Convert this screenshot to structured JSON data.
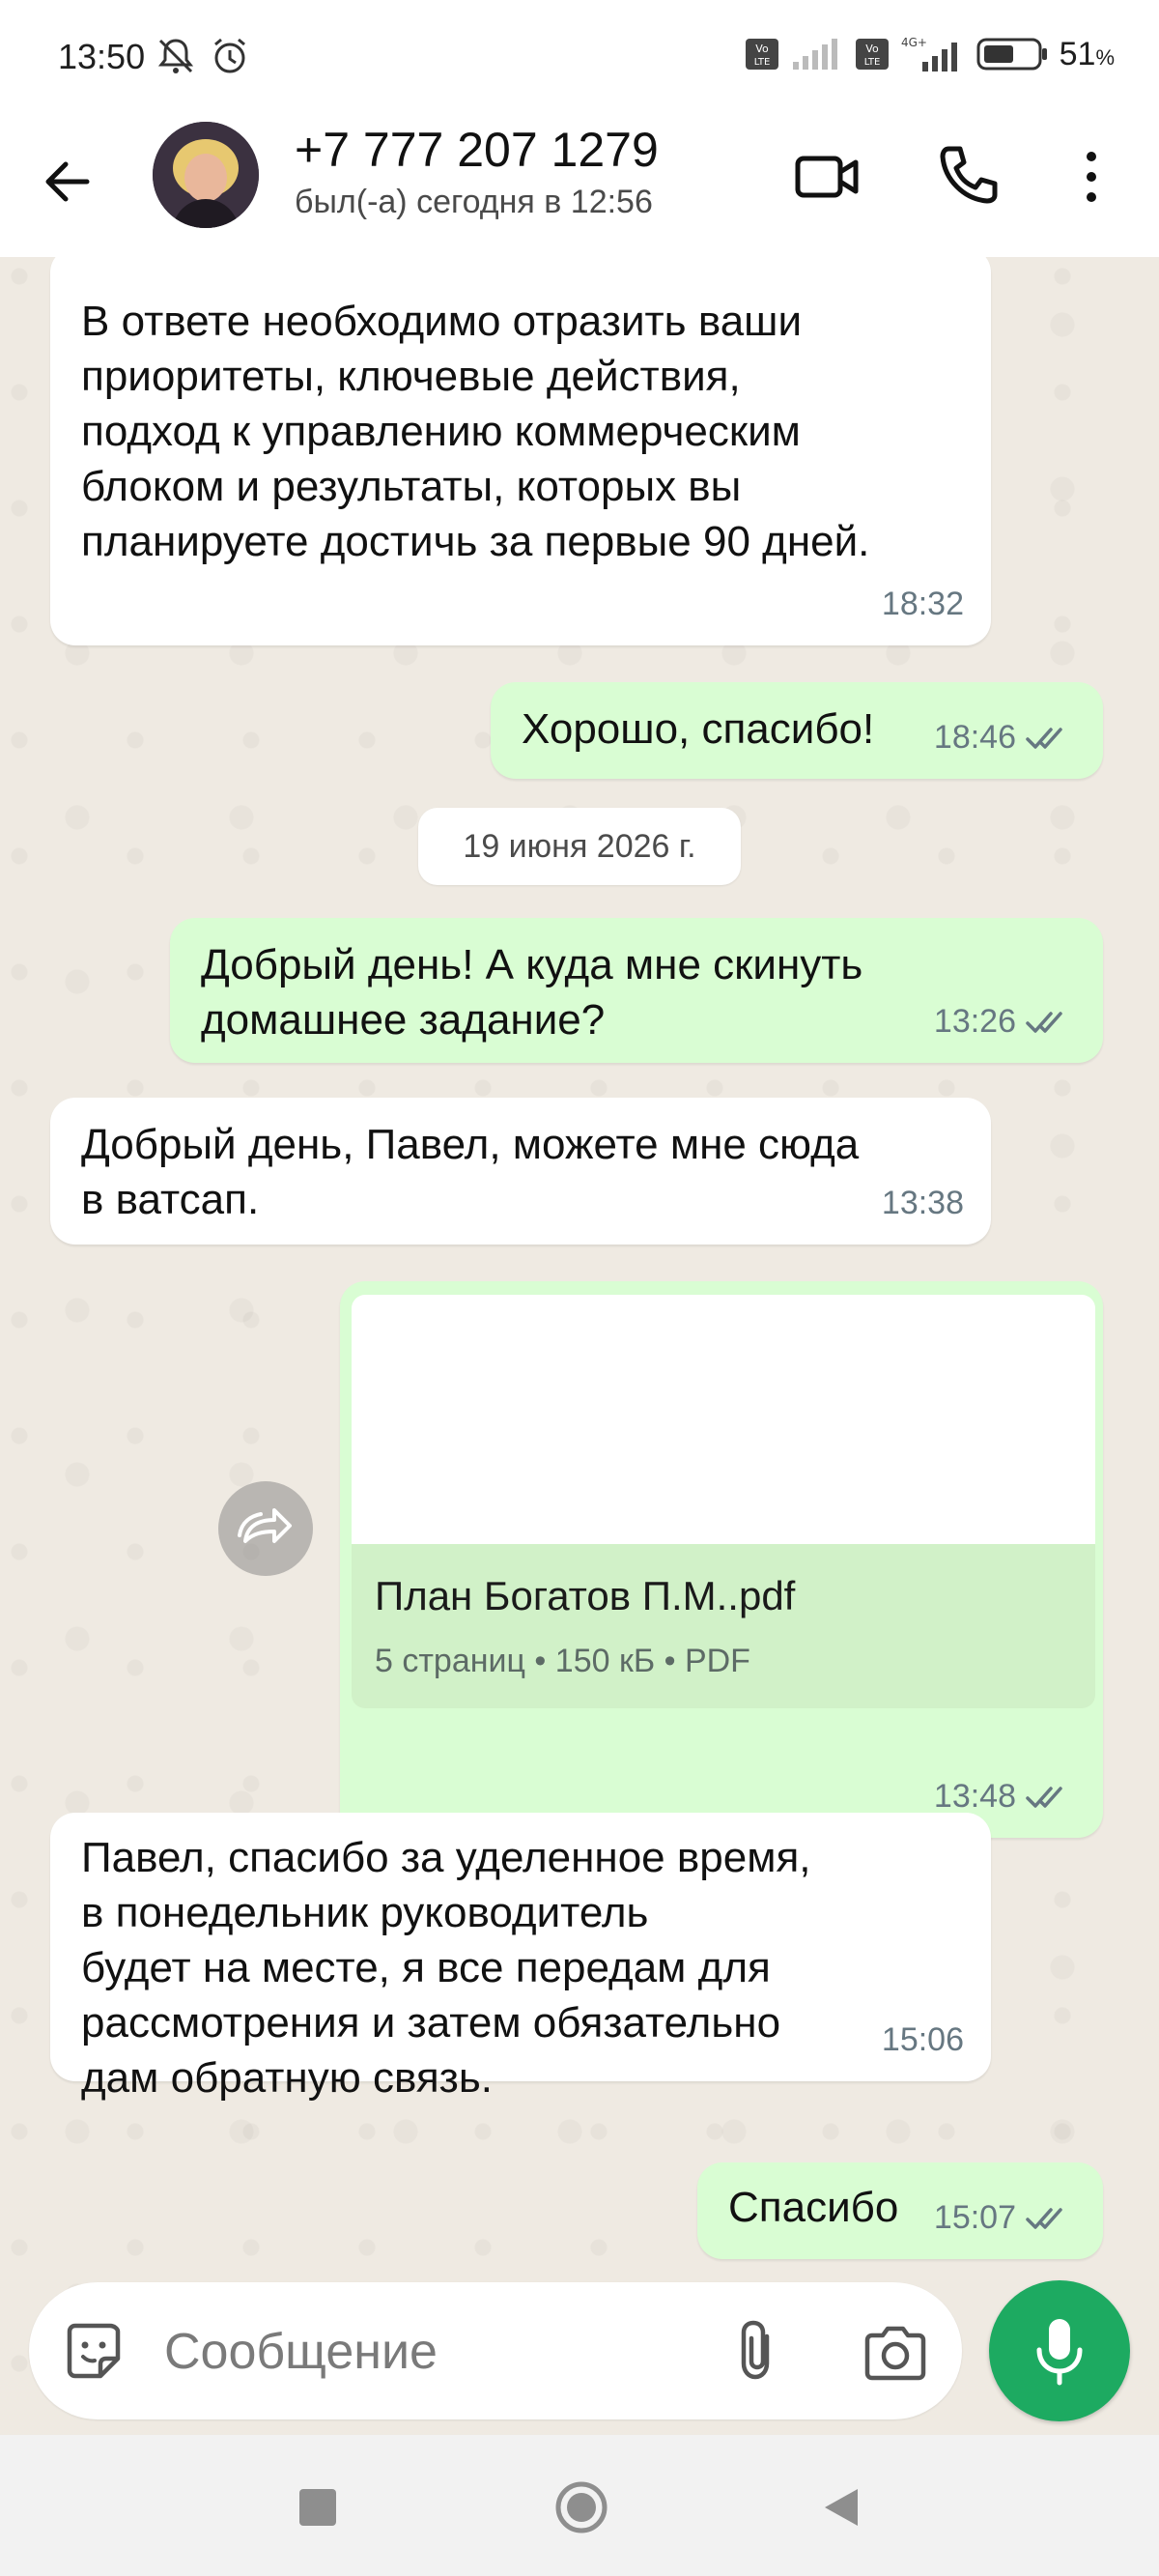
{
  "status_bar": {
    "time": "13:50",
    "battery_percent": "51",
    "battery_unit": "%"
  },
  "header": {
    "contact_name": "+7 777 207 1279",
    "last_seen": "был(-а) сегодня в 12:56"
  },
  "messages": [
    {
      "direction": "in",
      "text": "В ответе необходимо отразить ваши\nприоритеты, ключевые действия,\nподход к управлению коммерческим\nблоком и результаты, которых вы\nпланируете достичь за первые 90 дней.",
      "time": "18:32"
    },
    {
      "direction": "out",
      "text": "Хорошо, спасибо!",
      "time": "18:46",
      "status": "read"
    },
    {
      "direction": "date",
      "text": "19 июня 2026 г."
    },
    {
      "direction": "out",
      "text": "Добрый день! А куда мне скинуть\nдомашнее задание?",
      "time": "13:26",
      "status": "read"
    },
    {
      "direction": "in",
      "text": "Добрый день, Павел, можете мне сюда\nв ватсап.",
      "time": "13:38"
    },
    {
      "direction": "out",
      "type": "document",
      "file_name": "План Богатов П.М..pdf",
      "file_details": "5 страниц • 150 кБ • PDF",
      "time": "13:48",
      "status": "read"
    },
    {
      "direction": "in",
      "text": "Павел, спасибо за уделенное время,\nв понедельник руководитель\nбудет на месте, я все передам для\nрассмотрения и затем обязательно\nдам обратную связь.",
      "time": "15:06"
    },
    {
      "direction": "out",
      "text": "Спасибо",
      "time": "15:07",
      "status": "read"
    }
  ],
  "input": {
    "placeholder": "Сообщение"
  },
  "colors": {
    "outgoing_bubble": "#d9fdd3",
    "incoming_bubble": "#ffffff",
    "accent_green": "#1daa61",
    "read_ticks": "#667781"
  }
}
